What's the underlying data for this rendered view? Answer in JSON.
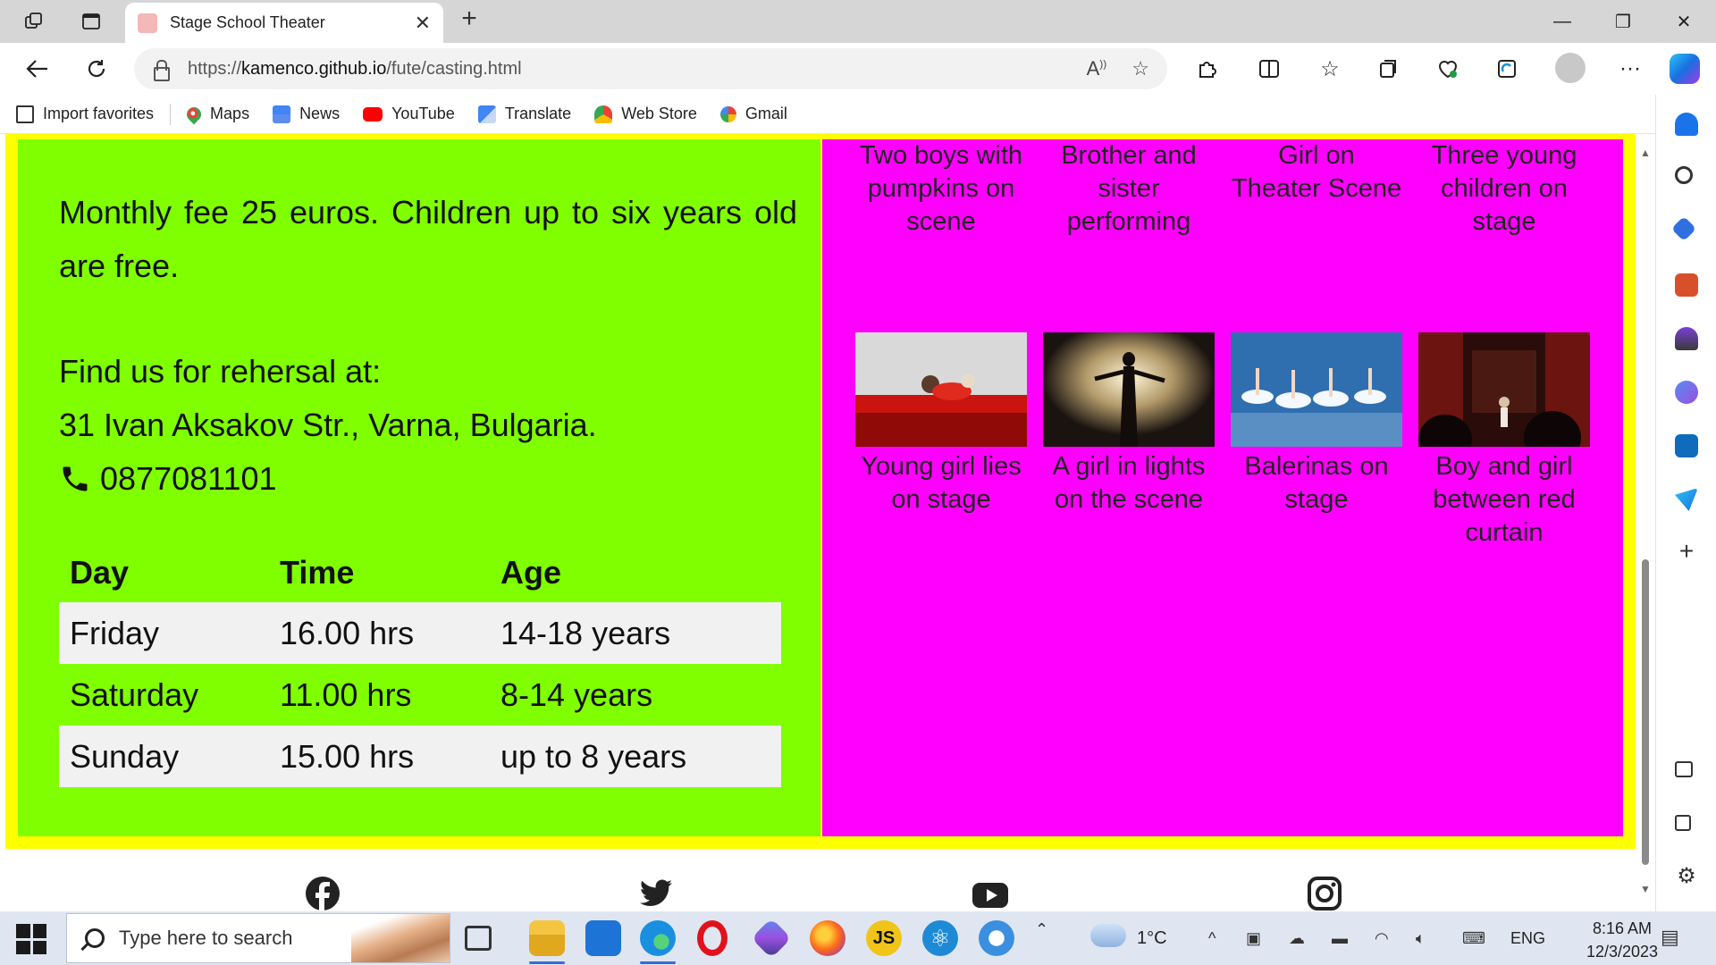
{
  "browser": {
    "tab_title": "Stage School Theater",
    "url_prefix": "https://",
    "url_host": "kamenco.github.io",
    "url_path": "/fute/casting.html",
    "favorites": [
      {
        "label": "Import favorites",
        "icon": "import-icon"
      },
      {
        "label": "Maps",
        "icon": "maps-icon"
      },
      {
        "label": "News",
        "icon": "news-icon"
      },
      {
        "label": "YouTube",
        "icon": "youtube-icon"
      },
      {
        "label": "Translate",
        "icon": "translate-icon"
      },
      {
        "label": "Web Store",
        "icon": "webstore-icon"
      },
      {
        "label": "Gmail",
        "icon": "gmail-icon"
      }
    ]
  },
  "page": {
    "colors": {
      "frame": "#ffff00",
      "info_panel": "#7fff00",
      "gallery_panel": "#ff00ff"
    },
    "fee_text": "Monthly fee 25 euros. Children up to six years old are free.",
    "rehearsal_label": "Find us for rehersal at:",
    "address": "31 Ivan Aksakov Str., Varna, Bulgaria.",
    "phone": "0877081101",
    "schedule": {
      "headers": [
        "Day",
        "Time",
        "Age"
      ],
      "rows": [
        [
          "Friday",
          "16.00 hrs",
          "14-18 years"
        ],
        [
          "Saturday",
          "11.00 hrs",
          "8-14 years"
        ],
        [
          "Sunday",
          "15.00 hrs",
          "up to 8 years"
        ]
      ]
    },
    "gallery_top_captions": [
      "Two boys with pumpkins on scene",
      "Brother and sister performing",
      "Girl on Theater Scene",
      "Three young children on stage"
    ],
    "gallery_bottom_captions": [
      "Young girl lies on stage",
      "A girl in lights on the scene",
      "Balerinas on stage",
      "Boy and girl between red curtain"
    ],
    "social": [
      "facebook-icon",
      "twitter-icon",
      "youtube-icon",
      "instagram-icon"
    ]
  },
  "taskbar": {
    "search_placeholder": "Type here to search",
    "temperature": "1°C",
    "language": "ENG",
    "time": "8:16 AM",
    "date": "12/3/2023"
  }
}
